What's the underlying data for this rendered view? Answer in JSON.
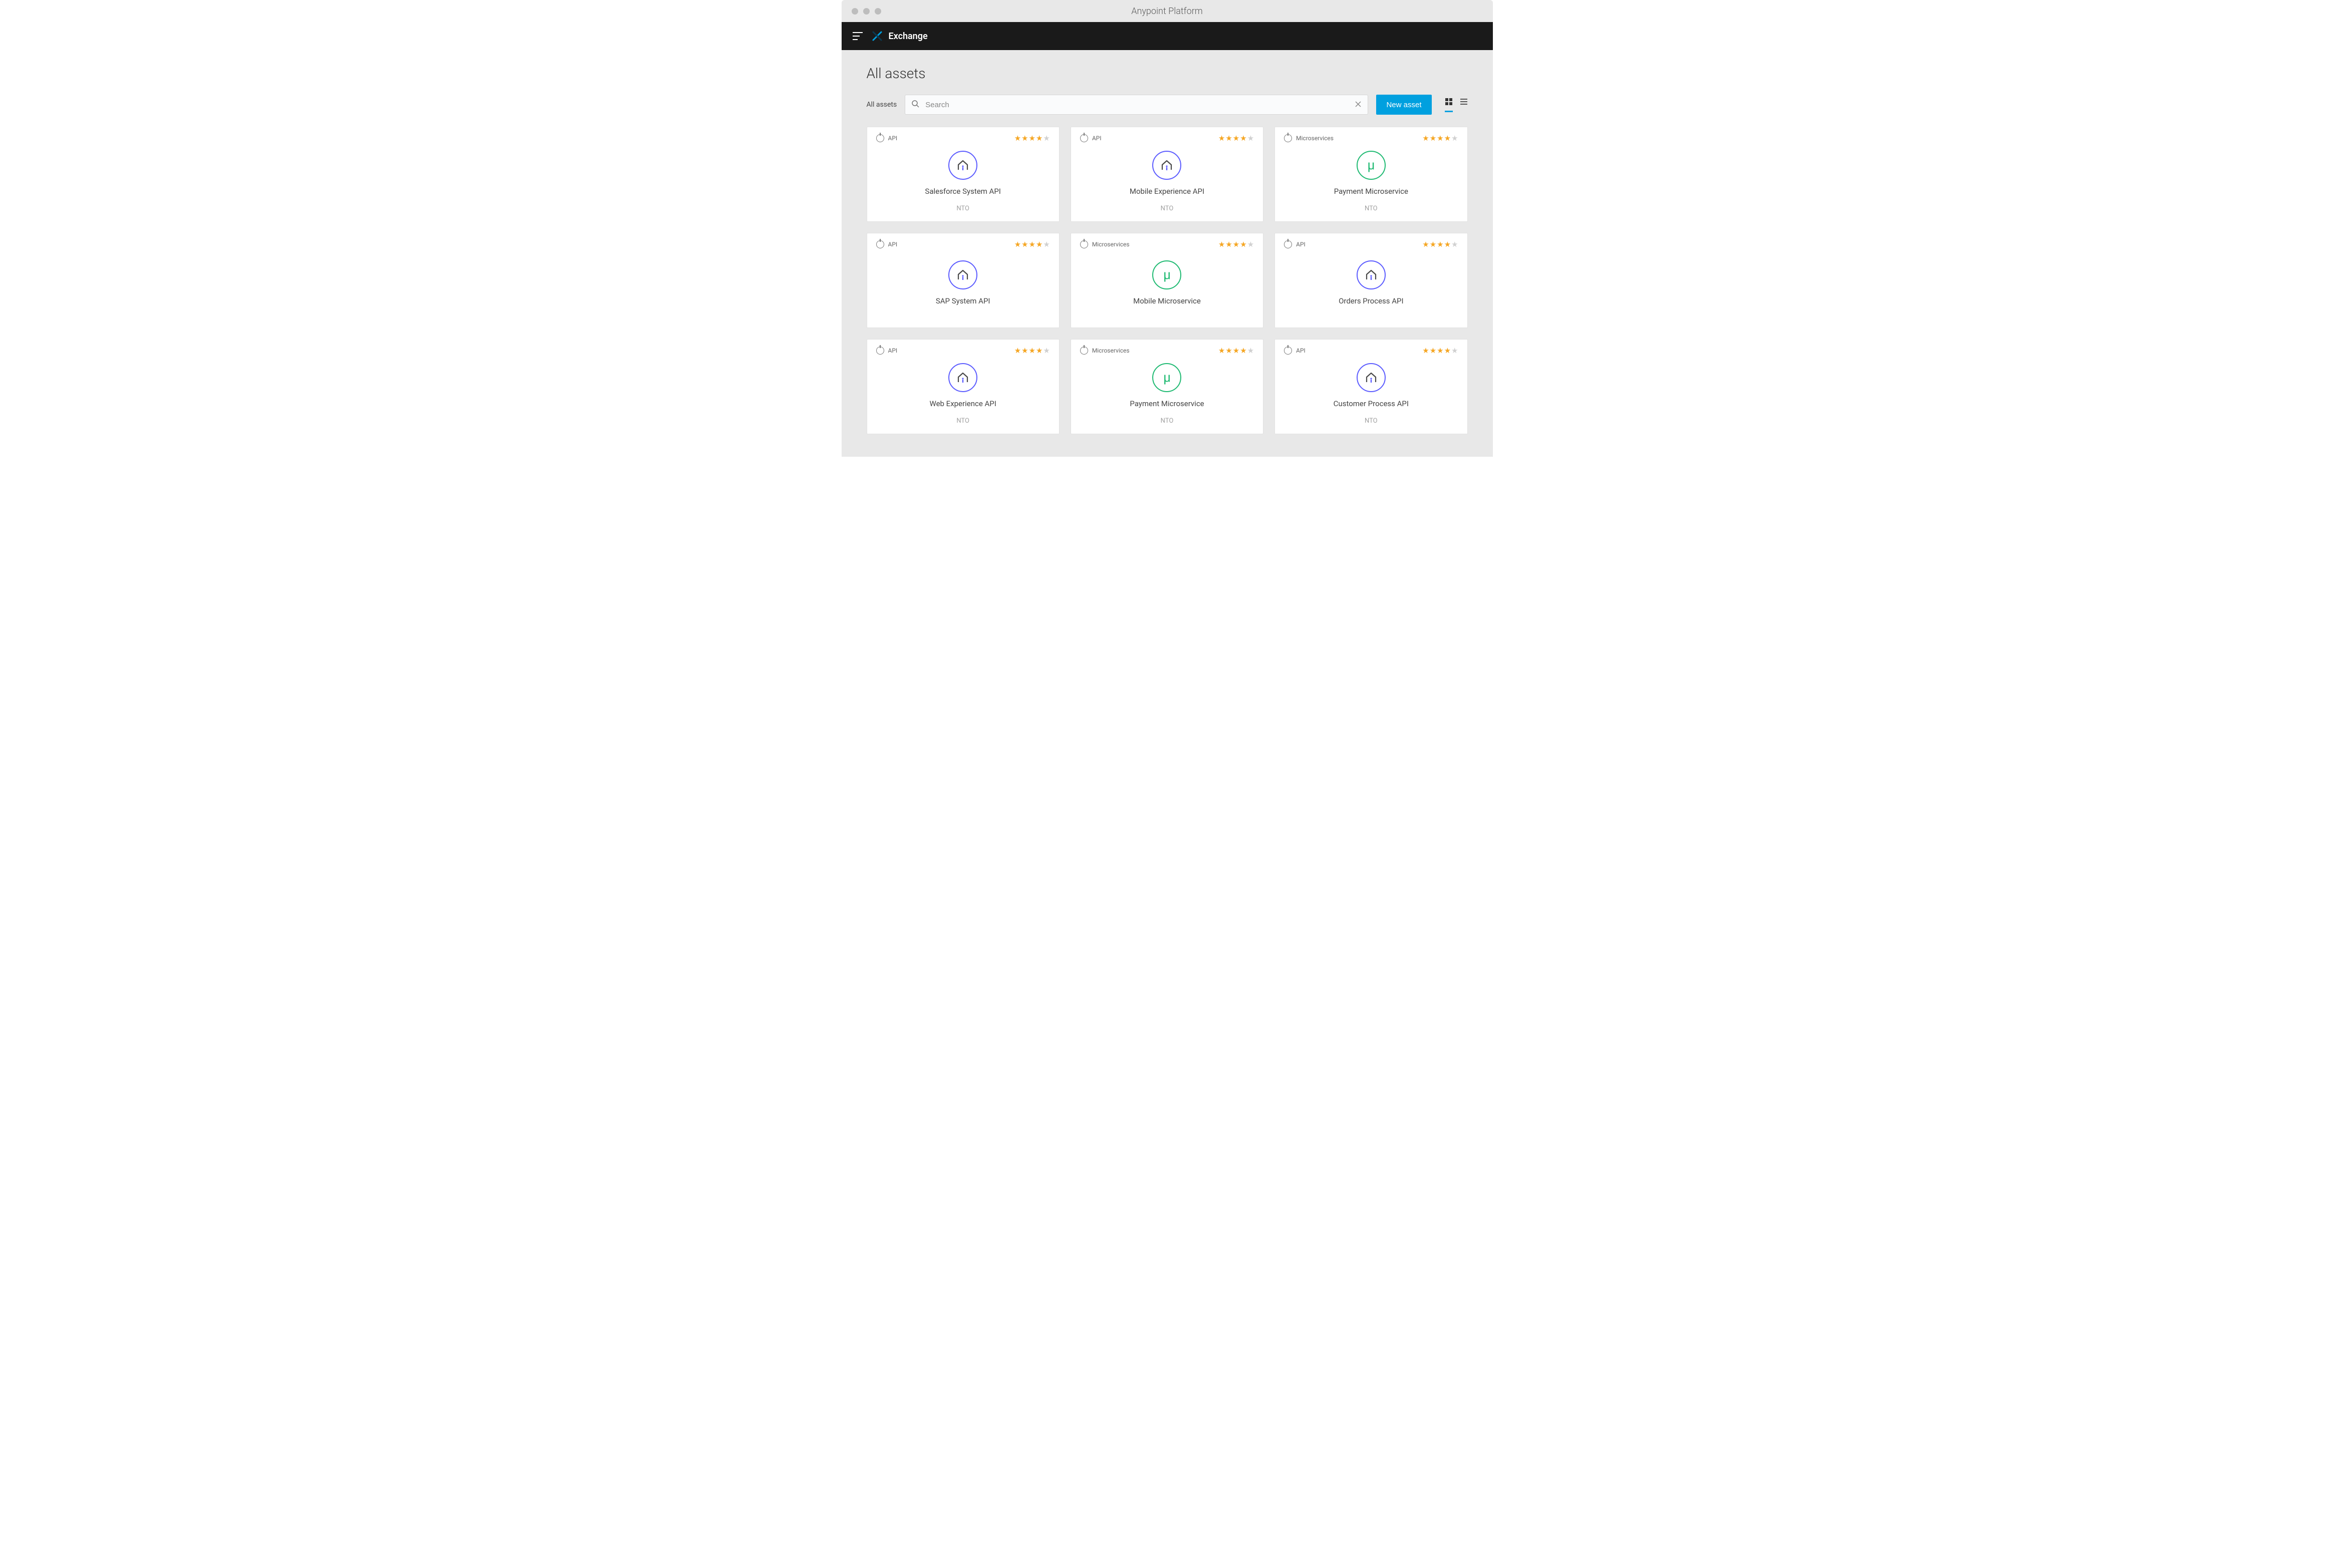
{
  "window": {
    "title": "Anypoint Platform"
  },
  "header": {
    "brand": "Exchange"
  },
  "page": {
    "title": "All assets",
    "filter_label": "All assets",
    "search_placeholder": "Search",
    "new_asset_label": "New asset"
  },
  "cards": [
    {
      "type": "API",
      "title": "Salesforce System API",
      "org": "NTO",
      "rating": 4,
      "icon": "api"
    },
    {
      "type": "API",
      "title": "Mobile Experience API",
      "org": "NTO",
      "rating": 4,
      "icon": "api"
    },
    {
      "type": "Microservices",
      "title": "Payment Microservice",
      "org": "NTO",
      "rating": 4,
      "icon": "micro"
    },
    {
      "type": "API",
      "title": "SAP System API",
      "org": "",
      "rating": 4,
      "icon": "api"
    },
    {
      "type": "Microservices",
      "title": "Mobile Microservice",
      "org": "",
      "rating": 4,
      "icon": "micro"
    },
    {
      "type": "API",
      "title": "Orders Process API",
      "org": "",
      "rating": 4,
      "icon": "api"
    },
    {
      "type": "API",
      "title": "Web Experience API",
      "org": "NTO",
      "rating": 4,
      "icon": "api"
    },
    {
      "type": "Microservices",
      "title": "Payment Microservice",
      "org": "NTO",
      "rating": 4,
      "icon": "micro"
    },
    {
      "type": "API",
      "title": "Customer Process API",
      "org": "NTO",
      "rating": 4,
      "icon": "api"
    }
  ]
}
